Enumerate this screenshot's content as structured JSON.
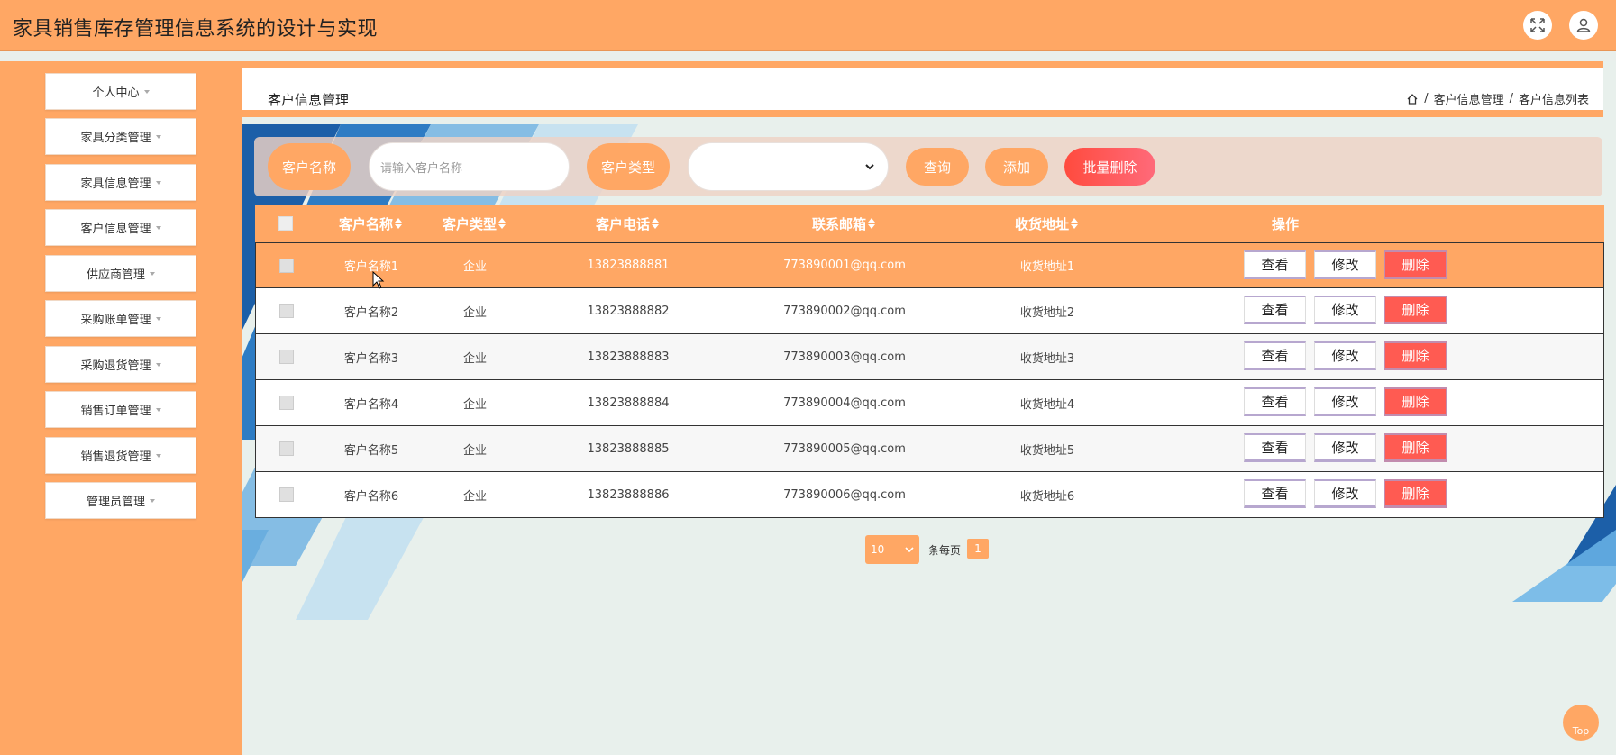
{
  "header": {
    "title": "家具销售库存管理信息系统的设计与实现",
    "fullscreen_icon": "fullscreen-icon",
    "user_icon": "user-icon"
  },
  "sidebar": {
    "items": [
      {
        "label": "个人中心"
      },
      {
        "label": "家具分类管理"
      },
      {
        "label": "家具信息管理"
      },
      {
        "label": "客户信息管理"
      },
      {
        "label": "供应商管理"
      },
      {
        "label": "采购账单管理"
      },
      {
        "label": "采购退货管理"
      },
      {
        "label": "销售订单管理"
      },
      {
        "label": "销售退货管理"
      },
      {
        "label": "管理员管理"
      }
    ]
  },
  "page": {
    "section_title": "客户信息管理",
    "breadcrumb": {
      "sep": "/",
      "level1": "客户信息管理",
      "level2": "客户信息列表"
    }
  },
  "search": {
    "name_label": "客户名称",
    "name_placeholder": "请输入客户名称",
    "type_label": "客户类型",
    "type_value": "",
    "query_button": "查询",
    "add_button": "添加",
    "batch_delete_button": "批量删除"
  },
  "table": {
    "headers": {
      "name": "客户名称",
      "type": "客户类型",
      "phone": "客户电话",
      "email": "联系邮箱",
      "address": "收货地址",
      "actions": "操作"
    },
    "action_labels": {
      "view": "查看",
      "edit": "修改",
      "delete": "删除"
    },
    "rows": [
      {
        "name": "客户名称1",
        "type": "企业",
        "phone": "13823888881",
        "email": "773890001@qq.com",
        "address": "收货地址1"
      },
      {
        "name": "客户名称2",
        "type": "企业",
        "phone": "13823888882",
        "email": "773890002@qq.com",
        "address": "收货地址2"
      },
      {
        "name": "客户名称3",
        "type": "企业",
        "phone": "13823888883",
        "email": "773890003@qq.com",
        "address": "收货地址3"
      },
      {
        "name": "客户名称4",
        "type": "企业",
        "phone": "13823888884",
        "email": "773890004@qq.com",
        "address": "收货地址4"
      },
      {
        "name": "客户名称5",
        "type": "企业",
        "phone": "13823888885",
        "email": "773890005@qq.com",
        "address": "收货地址5"
      },
      {
        "name": "客户名称6",
        "type": "企业",
        "phone": "13823888886",
        "email": "773890006@qq.com",
        "address": "收货地址6"
      }
    ]
  },
  "pagination": {
    "page_size": "10",
    "per_page_label": "条每页",
    "current_page": "1"
  },
  "back_to_top": "Top",
  "colors": {
    "accent": "#ffa764",
    "danger": "#ff5b52",
    "batch_delete": "#ff5a5a"
  }
}
